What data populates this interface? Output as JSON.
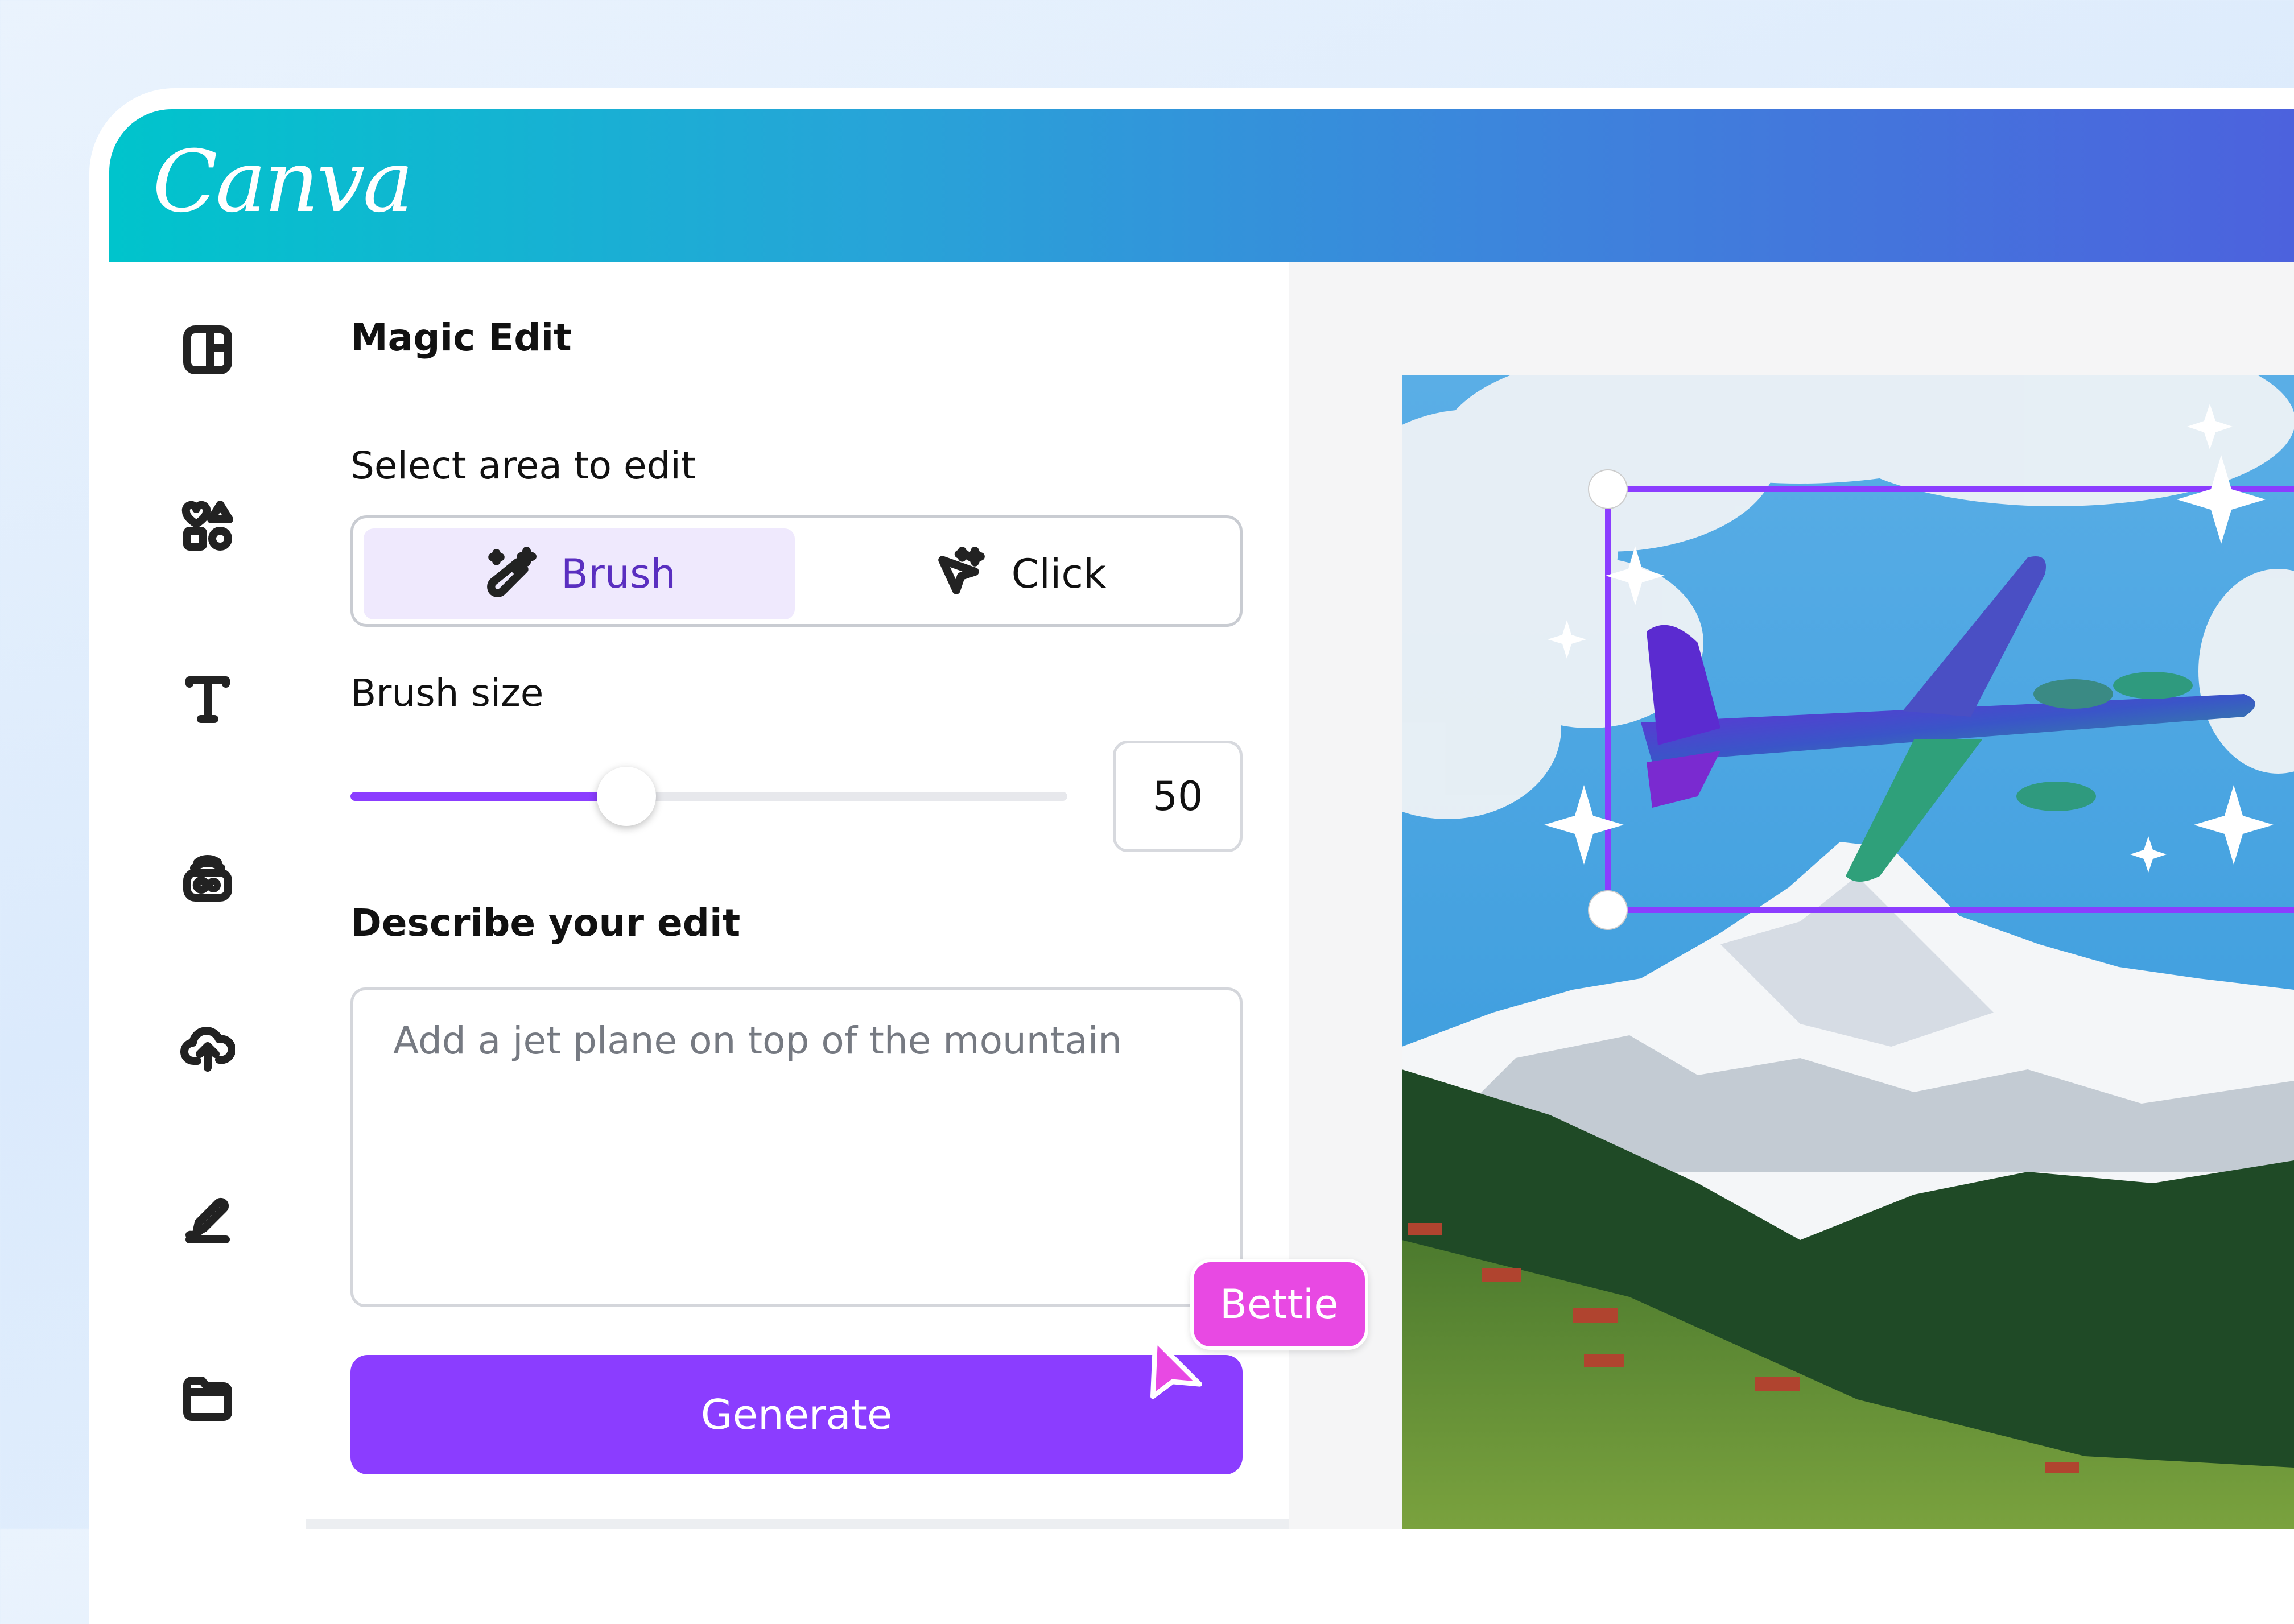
{
  "app": {
    "logo_text": "Canva"
  },
  "sidebar": {
    "items": [
      {
        "icon": "layout-icon"
      },
      {
        "icon": "elements-icon"
      },
      {
        "icon": "text-icon"
      },
      {
        "icon": "brand-icon"
      },
      {
        "icon": "uploads-icon"
      },
      {
        "icon": "draw-icon"
      },
      {
        "icon": "projects-icon"
      }
    ]
  },
  "panel": {
    "title": "Magic Edit",
    "select_area_label": "Select area to edit",
    "modes": [
      {
        "label": "Brush",
        "icon": "magic-brush-icon",
        "active": true
      },
      {
        "label": "Click",
        "icon": "magic-click-icon",
        "active": false
      }
    ],
    "brush_size_label": "Brush size",
    "brush_size": {
      "value": "50",
      "min": 0,
      "max": 130,
      "level": 50
    },
    "describe_label": "Describe your edit",
    "describe_placeholder": "Add a jet plane on top of the mountain",
    "generate_label": "Generate"
  },
  "collaborator": {
    "name": "Bettie",
    "color": "#e849e3"
  },
  "colors": {
    "accent": "#8b3dff",
    "header_start": "#00c4cc",
    "header_end": "#4c62dd"
  }
}
